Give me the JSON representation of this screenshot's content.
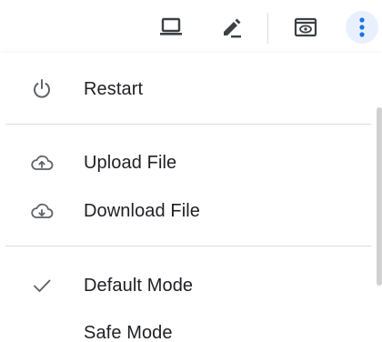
{
  "toolbar": {
    "buttons": [
      {
        "icon": "laptop-icon"
      },
      {
        "icon": "pencil-icon"
      },
      {
        "icon": "preview-icon"
      },
      {
        "icon": "more-vert-icon",
        "active_bg": "#e8f0fe"
      }
    ]
  },
  "menu": {
    "items": [
      {
        "icon": "power-icon",
        "label": "Restart"
      },
      {
        "icon": "cloud-upload-icon",
        "label": "Upload File"
      },
      {
        "icon": "cloud-download-icon",
        "label": "Download File"
      },
      {
        "icon": "check-icon",
        "label": "Default Mode",
        "checked": true
      },
      {
        "icon": "",
        "label": "Safe Mode",
        "checked": false
      }
    ]
  },
  "colors": {
    "icon": "#5f6368",
    "accent": "#1a73e8",
    "divider": "#dadce0",
    "text": "#202124"
  }
}
